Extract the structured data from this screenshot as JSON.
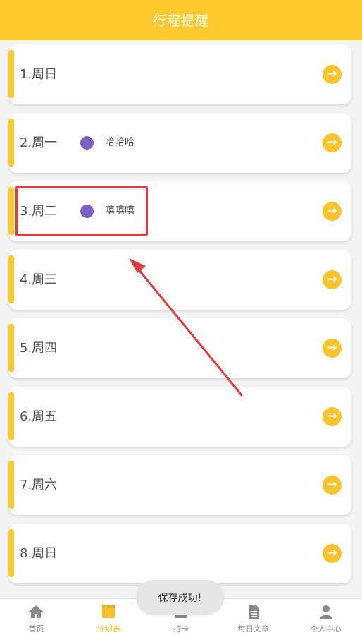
{
  "header": {
    "title": "行程提醒"
  },
  "colors": {
    "accent": "#fec92d",
    "dot": "#7e5ec1",
    "annotation": "#e23b3b"
  },
  "plans": [
    {
      "day": "1.周日",
      "note": ""
    },
    {
      "day": "2.周一",
      "note": "哈哈哈"
    },
    {
      "day": "3.周二",
      "note": "嘻嘻嘻"
    },
    {
      "day": "4.周三",
      "note": ""
    },
    {
      "day": "5.周四",
      "note": ""
    },
    {
      "day": "6.周五",
      "note": ""
    },
    {
      "day": "7.周六",
      "note": ""
    },
    {
      "day": "8.周日",
      "note": ""
    }
  ],
  "tabs": [
    {
      "label": "首页",
      "icon": "home-icon"
    },
    {
      "label": "计划表",
      "icon": "schedule-icon",
      "active": true
    },
    {
      "label": "打卡",
      "icon": "checkin-icon"
    },
    {
      "label": "每日文章",
      "icon": "document-icon"
    },
    {
      "label": "个人中心",
      "icon": "user-icon"
    }
  ],
  "toast": {
    "message": "保存成功!"
  }
}
